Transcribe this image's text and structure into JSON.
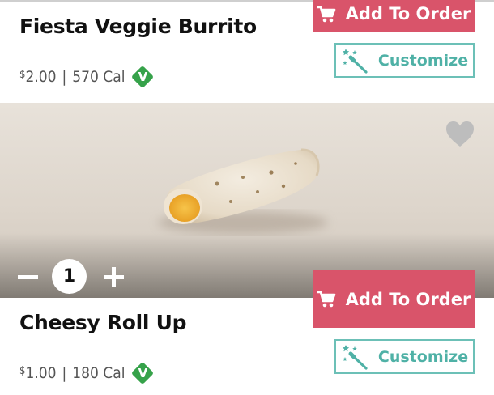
{
  "items": [
    {
      "name": "Fiesta Veggie Burrito",
      "price_symbol": "$",
      "price_amount": "2.00",
      "separator": "|",
      "calories": "570 Cal",
      "badge": "V",
      "add_label": "Add To Order",
      "customize_label": "Customize"
    },
    {
      "name": "Cheesy Roll Up",
      "price_symbol": "$",
      "price_amount": "1.00",
      "separator": "|",
      "calories": "180 Cal",
      "badge": "V",
      "add_label": "Add To Order",
      "customize_label": "Customize",
      "quantity": "1"
    }
  ],
  "icons": {
    "cart": "cart-icon",
    "wand": "magic-wand-icon",
    "heart": "heart-icon",
    "minus": "minus-icon",
    "plus": "plus-icon"
  },
  "colors": {
    "add_button": "#d9546a",
    "customize_accent": "#4fb1a6",
    "veggie_badge": "#36a24a",
    "favorite_heart": "#bdbdbd"
  }
}
